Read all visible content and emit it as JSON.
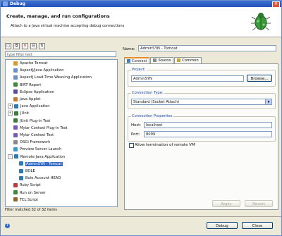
{
  "window": {
    "title": "Debug",
    "close_glyph": "✕"
  },
  "banner": {
    "heading": "Create, manage, and run configurations",
    "subtext": "Attach to a Java virtual machine accepting debug connections",
    "icon": "bug-icon"
  },
  "left": {
    "toolbar": [
      {
        "name": "new-config-icon",
        "glyph": "□"
      },
      {
        "name": "duplicate-icon",
        "glyph": "⧉"
      },
      {
        "name": "delete-icon",
        "glyph": "✕"
      },
      {
        "name": "collapse-icon",
        "glyph": "⊟"
      },
      {
        "name": "filter-icon",
        "glyph": "⇅"
      }
    ],
    "filter_placeholder": "type filter text",
    "tree": [
      {
        "label": "Apache Tomcat",
        "indent": 1,
        "color": "#d99a2b"
      },
      {
        "label": "AspectJ/Java Application",
        "indent": 1,
        "color": "#6a8fc9"
      },
      {
        "label": "AspectJ Load-Time Weaving Application",
        "indent": 1,
        "color": "#6a8fc9"
      },
      {
        "label": "BIRT Report",
        "indent": 1,
        "color": "#3d8a3d"
      },
      {
        "label": "Eclipse Application",
        "indent": 1,
        "color": "#5a4ea8"
      },
      {
        "label": "Java Applet",
        "indent": 1,
        "color": "#c77a2a"
      },
      {
        "label": "Java Application",
        "indent": 0,
        "exp": "+",
        "color": "#2b7ab8"
      },
      {
        "label": "JUnit",
        "indent": 0,
        "exp": "+",
        "color": "#3a7a3a"
      },
      {
        "label": "JUnit Plug-in Test",
        "indent": 1,
        "color": "#3a7a3a"
      },
      {
        "label": "Mylar Context Plug-in Test",
        "indent": 1,
        "color": "#7a5ab8"
      },
      {
        "label": "Mylar Context Test",
        "indent": 1,
        "color": "#7a5ab8"
      },
      {
        "label": "OSGi Framework",
        "indent": 1,
        "color": "#8a8a8a"
      },
      {
        "label": "Preview Server Launch",
        "indent": 1,
        "color": "#3b9ac9"
      },
      {
        "label": "Remote Java Application",
        "indent": 0,
        "exp": "−",
        "color": "#2b7ab8"
      },
      {
        "label": "AdminSYN - Tomcat",
        "indent": 2,
        "color": "#2b7ab8",
        "selected": true
      },
      {
        "label": "BOLE",
        "indent": 2,
        "color": "#2b7ab8"
      },
      {
        "label": "Bole Account HEAD",
        "indent": 2,
        "color": "#2b7ab8"
      },
      {
        "label": "Ruby Script",
        "indent": 1,
        "color": "#b83a3a"
      },
      {
        "label": "Run on Server",
        "indent": 1,
        "color": "#3a8a3a"
      },
      {
        "label": "TCL Script",
        "indent": 1,
        "color": "#8a6a2a"
      }
    ],
    "status": "Filter matched 32 of 32 items"
  },
  "right": {
    "name_label": "Name:",
    "name_value": "AdminSYN - Tomcat",
    "tabs": [
      {
        "label": "Connect",
        "active": true,
        "icon": "connect-icon"
      },
      {
        "label": "Source",
        "active": false,
        "icon": "source-icon"
      },
      {
        "label": "Common",
        "active": false,
        "icon": "common-icon"
      }
    ],
    "project": {
      "legend": "Project:",
      "value": "AdminSYN",
      "browse": "Browse..."
    },
    "connection_type": {
      "legend": "Connection Type:",
      "value": "Standard (Socket Attach)"
    },
    "connection_props": {
      "legend": "Connection Properties:",
      "host_label": "Host:",
      "host_value": "localhost",
      "port_label": "Port:",
      "port_value": "8099"
    },
    "allow_termination": "Allow termination of remote VM",
    "apply": "Apply",
    "revert": "Revert"
  },
  "bottom": {
    "help_glyph": "?",
    "debug": "Debug",
    "close": "Close"
  }
}
